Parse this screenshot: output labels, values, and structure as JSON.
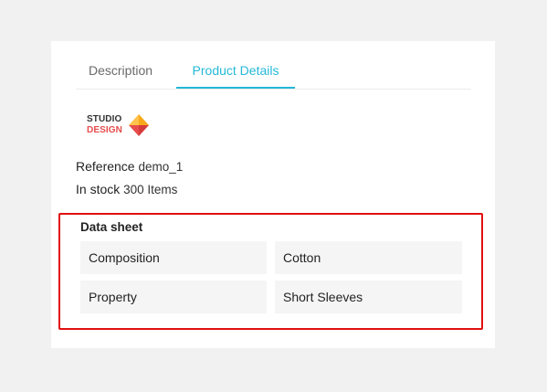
{
  "tabs": [
    {
      "label": "Description"
    },
    {
      "label": "Product Details"
    }
  ],
  "brand": {
    "line1": "STUDIO",
    "line2": "DESIGN",
    "colors": {
      "text": "#333333",
      "accent": "#e84c4c",
      "diamond_top": "#f7a81b",
      "diamond_bottom": "#e84c4c"
    }
  },
  "reference": {
    "label": "Reference",
    "value": "demo_1"
  },
  "stock": {
    "label": "In stock",
    "value": "300 Items"
  },
  "data_sheet": {
    "title": "Data sheet",
    "rows": [
      {
        "name": "Composition",
        "value": "Cotton"
      },
      {
        "name": "Property",
        "value": "Short Sleeves"
      }
    ]
  },
  "colors": {
    "accent": "#25b9d7",
    "highlight_border": "#e01010"
  }
}
